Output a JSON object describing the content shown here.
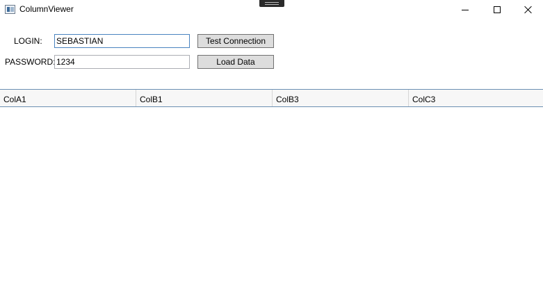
{
  "window": {
    "title": "ColumnViewer",
    "icon": "app-window-icon",
    "controls": [
      "minimize-icon",
      "maximize-icon",
      "close-icon"
    ]
  },
  "form": {
    "login_label": "LOGIN:",
    "login_value": "SEBASTIAN",
    "password_label": "PASSWORD:",
    "password_value": "1234",
    "test_connection_label": "Test Connection",
    "load_data_label": "Load Data"
  },
  "grid": {
    "columns": [
      "ColA1",
      "ColB1",
      "ColB3",
      "ColC3"
    ],
    "rows": []
  },
  "colors": {
    "focus_border": "#4a84c0",
    "button_face": "#dddddd",
    "grid_border": "#6b8fb2"
  }
}
